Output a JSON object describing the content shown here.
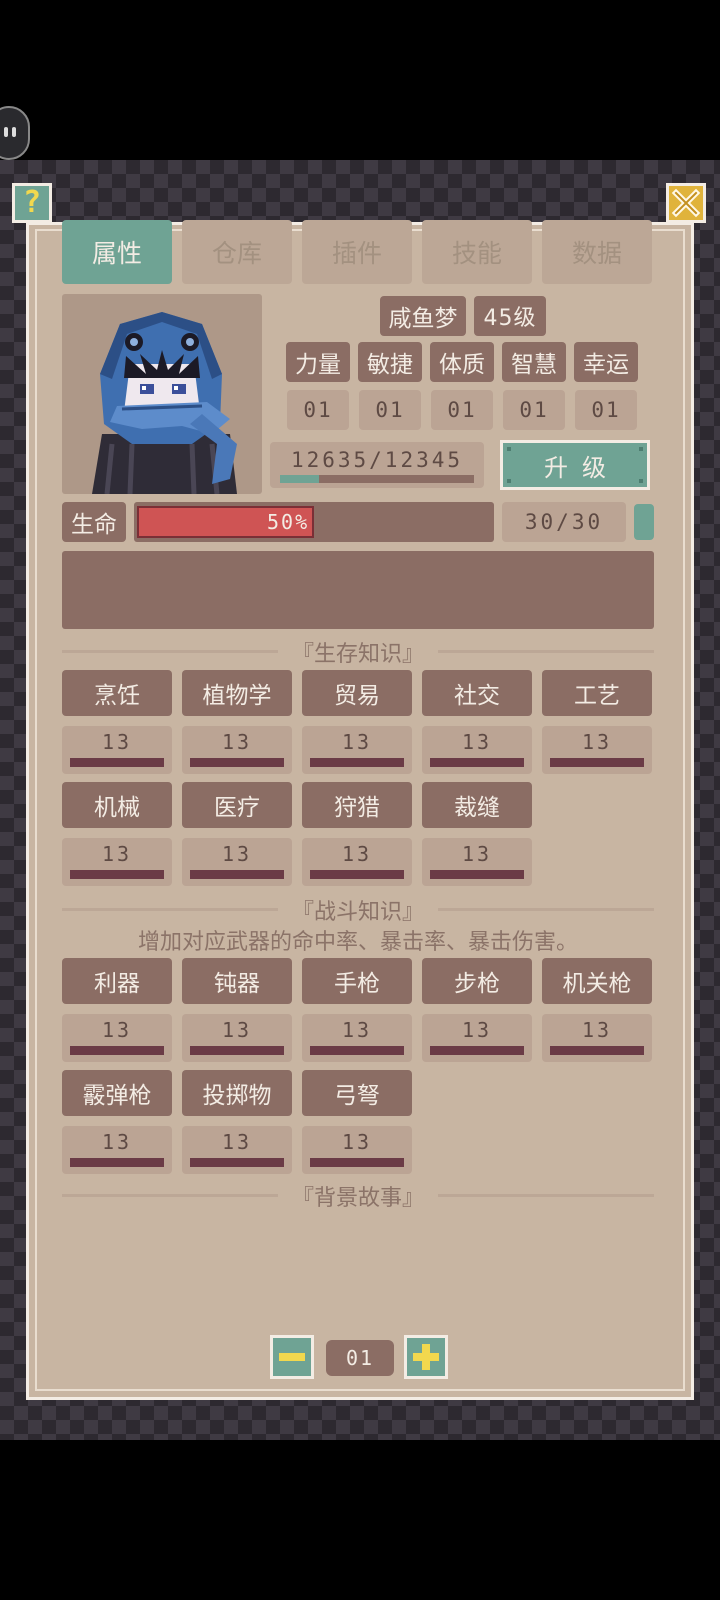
{
  "tabs": [
    "属性",
    "仓库",
    "插件",
    "技能",
    "数据"
  ],
  "active_tab": 0,
  "character": {
    "name": "咸鱼梦",
    "level": "45级"
  },
  "attributes": [
    {
      "label": "力量",
      "value": "01"
    },
    {
      "label": "敏捷",
      "value": "01"
    },
    {
      "label": "体质",
      "value": "01"
    },
    {
      "label": "智慧",
      "value": "01"
    },
    {
      "label": "幸运",
      "value": "01"
    }
  ],
  "experience": {
    "text": "12635/12345",
    "fill_fraction": 0.2
  },
  "upgrade_label": "升级",
  "health": {
    "label": "生命",
    "percent_text": "50%",
    "fill_fraction": 0.5,
    "value_text": "30/30"
  },
  "survival": {
    "title": "『生存知识』",
    "skills": [
      {
        "name": "烹饪",
        "value": "13"
      },
      {
        "name": "植物学",
        "value": "13"
      },
      {
        "name": "贸易",
        "value": "13"
      },
      {
        "name": "社交",
        "value": "13"
      },
      {
        "name": "工艺",
        "value": "13"
      },
      {
        "name": "机械",
        "value": "13"
      },
      {
        "name": "医疗",
        "value": "13"
      },
      {
        "name": "狩猎",
        "value": "13"
      },
      {
        "name": "裁缝",
        "value": "13"
      }
    ]
  },
  "combat": {
    "title": "『战斗知识』",
    "description": "增加对应武器的命中率、暴击率、暴击伤害。",
    "skills": [
      {
        "name": "利器",
        "value": "13"
      },
      {
        "name": "钝器",
        "value": "13"
      },
      {
        "name": "手枪",
        "value": "13"
      },
      {
        "name": "步枪",
        "value": "13"
      },
      {
        "name": "机关枪",
        "value": "13"
      },
      {
        "name": "霰弹枪",
        "value": "13"
      },
      {
        "name": "投掷物",
        "value": "13"
      },
      {
        "name": "弓弩",
        "value": "13"
      }
    ]
  },
  "background": {
    "title": "『背景故事』"
  },
  "pager": {
    "value": "01"
  },
  "icons": {
    "help": "?",
    "close": "close-icon",
    "minus": "minus-icon",
    "plus": "plus-icon"
  },
  "colors": {
    "accent_teal": "#6fa394",
    "chip_brown": "#8b6d64",
    "panel_bg": "#c8b5a2",
    "health_red": "#cf5454",
    "close_yellow": "#e0b33b"
  }
}
